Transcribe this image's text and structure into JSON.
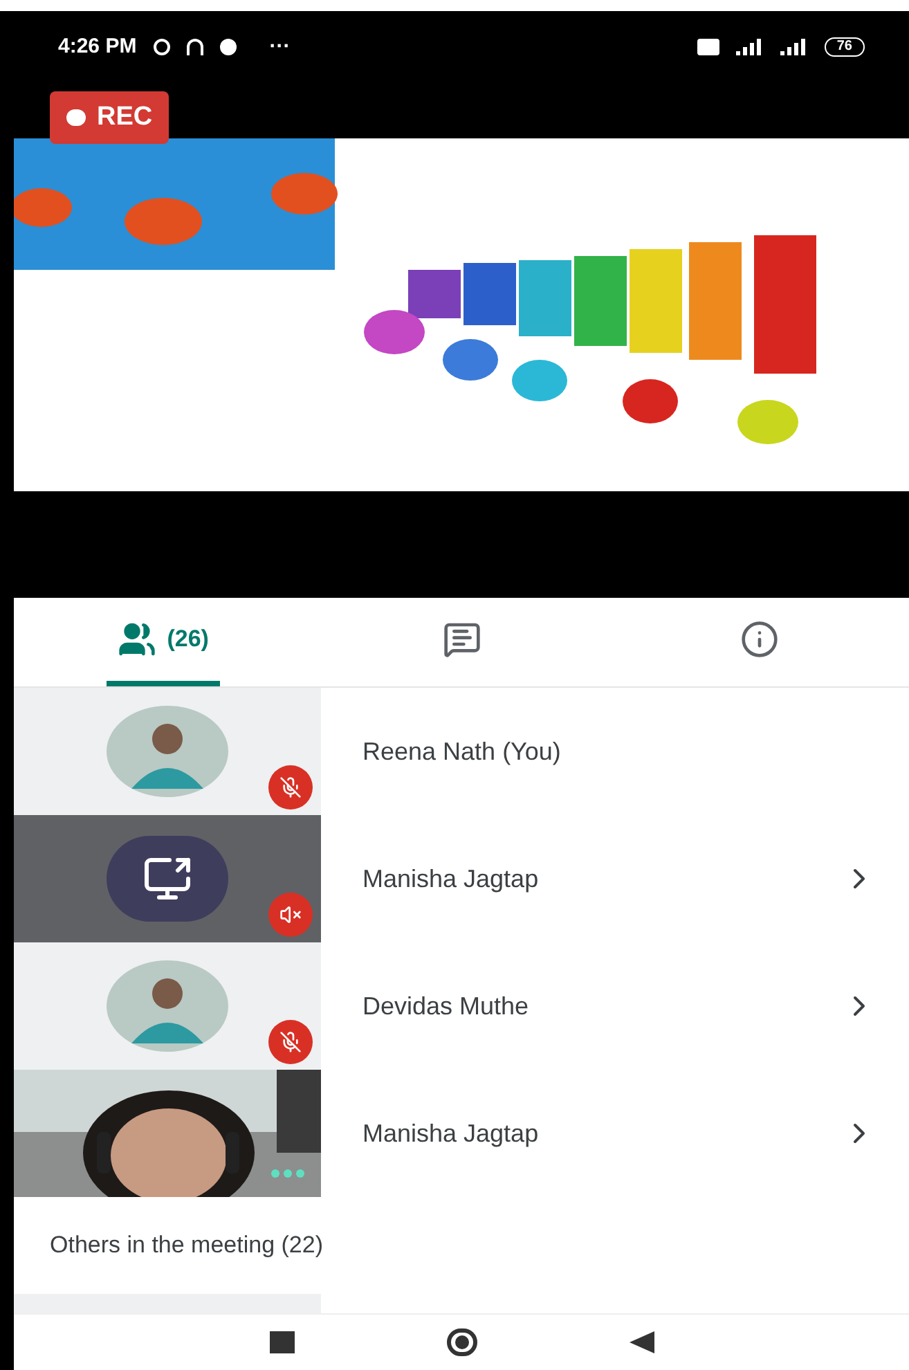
{
  "status_bar": {
    "time": "4:26 PM",
    "more": "···",
    "battery": "76"
  },
  "recording": {
    "label": "REC"
  },
  "tabs": [
    {
      "kind": "people",
      "count": "(26)",
      "selected": true
    },
    {
      "kind": "chat",
      "selected": false
    },
    {
      "kind": "info",
      "selected": false
    }
  ],
  "participants": [
    {
      "name": "Reena Nath (You)",
      "badge": {
        "kind": "mic-off"
      },
      "chevron": false
    },
    {
      "name": "Manisha Jagtap",
      "avatar": {
        "kind": "presenting"
      },
      "badge": {
        "kind": "volume-off"
      },
      "chevron": true
    },
    {
      "name": "Devidas Muthe",
      "badge": {
        "kind": "mic-off"
      },
      "chevron": true
    },
    {
      "name": "Manisha Jagtap",
      "avatar": {
        "kind": "video"
      },
      "badge": {
        "kind": "speaking"
      },
      "chevron": true
    }
  ],
  "others": {
    "heading": "Others in the meeting (22)"
  }
}
